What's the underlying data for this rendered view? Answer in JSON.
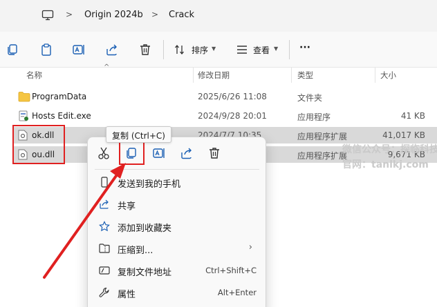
{
  "breadcrumb": {
    "items": [
      "Origin 2024b",
      "Crack"
    ],
    "separator": ">"
  },
  "toolbar": {
    "sort_label": "排序",
    "view_label": "查看",
    "more_label": "···"
  },
  "columns": {
    "name": "名称",
    "modified": "修改日期",
    "type": "类型",
    "size": "大小"
  },
  "files": [
    {
      "name": "ProgramData",
      "modified": "2025/6/26 11:08",
      "type": "文件夹",
      "size": "",
      "icon": "folder-icon",
      "selected": false
    },
    {
      "name": "Hosts Edit.exe",
      "modified": "2024/9/28 20:01",
      "type": "应用程序",
      "size": "41 KB",
      "icon": "exe-icon",
      "selected": false
    },
    {
      "name": "ok.dll",
      "modified": "2024/7/7 10:35",
      "type": "应用程序扩展",
      "size": "41,017 KB",
      "icon": "dll-icon",
      "selected": true
    },
    {
      "name": "ou.dll",
      "modified": "",
      "type": "应用程序扩展",
      "size": "9,671 KB",
      "icon": "dll-icon",
      "selected": true
    }
  ],
  "tooltip": "复制 (Ctrl+C)",
  "context_menu": {
    "quick_actions": [
      "cut-icon",
      "copy-icon",
      "rename-icon",
      "share-icon",
      "delete-icon"
    ],
    "items": [
      {
        "label": "发送到我的手机",
        "shortcut": "",
        "icon": "phone-icon",
        "submenu": false
      },
      {
        "label": "共享",
        "shortcut": "",
        "icon": "share-icon",
        "submenu": false
      },
      {
        "label": "添加到收藏夹",
        "shortcut": "",
        "icon": "star-icon",
        "submenu": false
      },
      {
        "label": "压缩到...",
        "shortcut": "",
        "icon": "zip-icon",
        "submenu": true
      },
      {
        "label": "复制文件地址",
        "shortcut": "Ctrl+Shift+C",
        "icon": "path-icon",
        "submenu": false
      },
      {
        "label": "属性",
        "shortcut": "Alt+Enter",
        "icon": "wrench-icon",
        "submenu": false
      }
    ]
  },
  "watermark": {
    "line1": "微信公众号：探临科技",
    "line2": "官网：tanlkj.com"
  },
  "colors": {
    "selection": "#d9d9d9",
    "highlight_box": "#e02020",
    "accent": "#1a5fb4"
  }
}
